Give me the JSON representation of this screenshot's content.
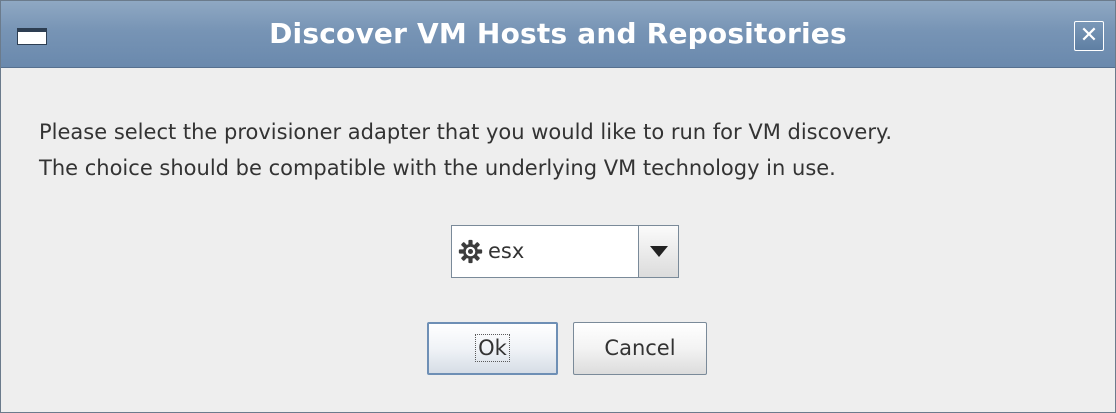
{
  "window": {
    "title": "Discover VM Hosts and Repositories",
    "icon": "window-menu-icon",
    "close_icon": "close-icon",
    "close_glyph": "✕"
  },
  "message": {
    "line1": "Please select the provisioner adapter that you would like to run for VM discovery.",
    "line2": "The choice should be compatible with the underlying VM technology in use."
  },
  "adapter_select": {
    "selected": "esx",
    "icon": "gear-icon",
    "arrow_icon": "chevron-down-icon"
  },
  "buttons": {
    "ok_label": "Ok",
    "cancel_label": "Cancel"
  }
}
